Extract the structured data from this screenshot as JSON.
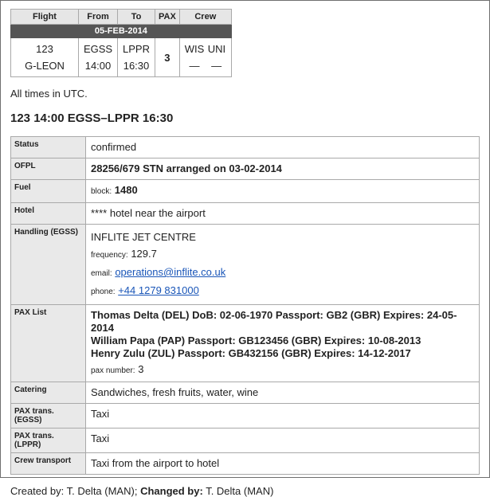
{
  "summary": {
    "headers": {
      "flight": "Flight",
      "from": "From",
      "to": "To",
      "pax": "PAX",
      "crew": "Crew"
    },
    "date": "05-FEB-2014",
    "row": {
      "flight_no": "123",
      "aircraft": "G-LEON",
      "from_icao": "EGSS",
      "from_time": "14:00",
      "to_icao": "LPPR",
      "to_time": "16:30",
      "pax": "3",
      "crew_codes": [
        "WIS",
        "UNI"
      ],
      "crew_roles": [
        "—",
        "—"
      ]
    }
  },
  "note": "All times in UTC.",
  "leg_heading": "123 14:00 EGSS–LPPR 16:30",
  "details": {
    "status": {
      "label": "Status",
      "value": "confirmed"
    },
    "ofpl": {
      "label": "OFPL",
      "value": "28256/679 STN arranged on 03-02-2014"
    },
    "fuel": {
      "label": "Fuel",
      "prefix": "block:",
      "value": "1480"
    },
    "hotel": {
      "label": "Hotel",
      "value": "**** hotel near the airport"
    },
    "handling": {
      "label": "Handling (EGSS)",
      "name": "INFLITE JET CENTRE",
      "frequency_label": "frequency:",
      "frequency": "129.7",
      "email_label": "email:",
      "email": "operations@inflite.co.uk",
      "phone_label": "phone:",
      "phone": "+44 1279 831000"
    },
    "pax_list": {
      "label": "PAX List",
      "passengers": [
        "Thomas Delta (DEL) DoB: 02-06-1970 Passport: GB2 (GBR) Expires: 24-05-2014",
        "William Papa (PAP) Passport: GB123456 (GBR) Expires: 10-08-2013",
        "Henry Zulu (ZUL) Passport: GB432156 (GBR) Expires: 14-12-2017"
      ],
      "pax_number_label": "pax number:",
      "pax_number": "3"
    },
    "catering": {
      "label": "Catering",
      "value": "Sandwiches, fresh fruits, water, wine"
    },
    "pax_trans_egss": {
      "label": "PAX trans. (EGSS)",
      "value": "Taxi"
    },
    "pax_trans_lppr": {
      "label": "PAX trans. (LPPR)",
      "value": "Taxi"
    },
    "crew_transport": {
      "label": "Crew transport",
      "value": "Taxi from the airport to hotel"
    }
  },
  "footer": {
    "created_label": "Created by:",
    "created_by": "T. Delta (MAN);",
    "changed_label": "Changed by:",
    "changed_by": "T. Delta (MAN)"
  }
}
